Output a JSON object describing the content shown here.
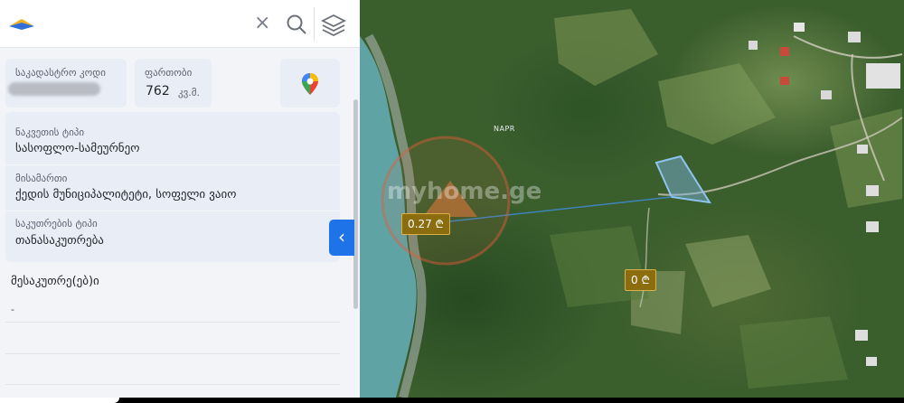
{
  "header": {
    "close_icon": "×"
  },
  "summary": {
    "cadastral_code_label": "საკადასტრო კოდი",
    "area_label": "ფართობი",
    "area_value": "762",
    "area_unit": "კვ.მ."
  },
  "details": {
    "cut_type_label": "ნაკვეთის ტიპი",
    "cut_type_value": "სასოფლო-სამეურნეო",
    "address_label": "მისამართი",
    "address_value": "ქედის მუნიციპალიტეტი, სოფელი ვაიო",
    "ownership_type_label": "საკუთრების ტიპი",
    "ownership_type_value": "თანასაკუთრება"
  },
  "owners": {
    "title": "მესაკუთრე(ებ)ი",
    "value": "-"
  },
  "map": {
    "place_label": "NAPR",
    "watermark": "myhome.ge",
    "price_tag_1": "0.27 ₾",
    "price_tag_2": "0 ₾",
    "parcel_color": "#7fb8e6",
    "river_color": "#5fa3a4"
  },
  "colors": {
    "accent": "#1e73e8",
    "price_tag": "#8b6d10"
  }
}
